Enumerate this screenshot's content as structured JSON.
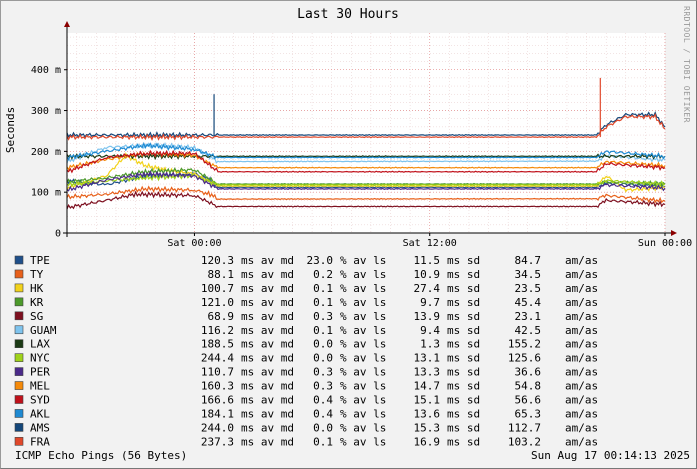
{
  "chart_data": {
    "type": "line",
    "title": "Last 30 Hours",
    "ylabel": "Seconds",
    "ylim": [
      0,
      490
    ],
    "y_ticks": [
      {
        "value": 0,
        "label": "0"
      },
      {
        "value": 100,
        "label": "100 m"
      },
      {
        "value": 200,
        "label": "200 m"
      },
      {
        "value": 300,
        "label": "300 m"
      },
      {
        "value": 400,
        "label": "400 m"
      }
    ],
    "xlim_hours": [
      -6.5,
      24
    ],
    "x_ticks": [
      {
        "value": 0,
        "label": "Sat 00:00"
      },
      {
        "value": 12,
        "label": "Sat 12:00"
      },
      {
        "value": 24,
        "label": "Sun 00:00"
      }
    ],
    "grid": true,
    "side_credit": "RRDTOOL / TOBI OETIKER",
    "legend_placement": "below",
    "series": [
      {
        "name": "TPE",
        "color": "#1f4f8a",
        "avg": "120.3",
        "loss": "23.0",
        "sd": "11.5",
        "amas": "84.7",
        "seg": [
          [
            -6.5,
            128
          ],
          [
            -4.5,
            118
          ],
          [
            -2.5,
            140
          ],
          [
            0,
            145
          ],
          [
            0.8,
            130
          ],
          [
            1.2,
            112
          ],
          [
            20.5,
            112
          ],
          [
            21,
            122
          ],
          [
            24,
            115
          ]
        ]
      },
      {
        "name": "TY",
        "color": "#e8601a",
        "avg": "88.1",
        "loss": "0.2",
        "sd": "10.9",
        "amas": "34.5",
        "seg": [
          [
            -6.5,
            88
          ],
          [
            -4.5,
            95
          ],
          [
            -2.5,
            108
          ],
          [
            0,
            105
          ],
          [
            0.8,
            95
          ],
          [
            1.2,
            83
          ],
          [
            20.5,
            84
          ],
          [
            21,
            92
          ],
          [
            24,
            78
          ]
        ]
      },
      {
        "name": "HK",
        "color": "#f2d21b",
        "avg": "100.7",
        "loss": "0.1",
        "sd": "27.4",
        "amas": "23.5",
        "seg": [
          [
            -6.5,
            110
          ],
          [
            -4.5,
            140
          ],
          [
            -3.5,
            190
          ],
          [
            -2.5,
            165
          ],
          [
            -1,
            150
          ],
          [
            0,
            145
          ],
          [
            1.2,
            115
          ],
          [
            20.5,
            115
          ],
          [
            21,
            140
          ],
          [
            22,
            105
          ],
          [
            24,
            112
          ]
        ]
      },
      {
        "name": "KR",
        "color": "#4c9a2a",
        "avg": "121.0",
        "loss": "0.1",
        "sd": "9.7",
        "amas": "45.4",
        "seg": [
          [
            -6.5,
            125
          ],
          [
            -4.5,
            135
          ],
          [
            -2.5,
            150
          ],
          [
            0,
            155
          ],
          [
            1.2,
            120
          ],
          [
            20.5,
            120
          ],
          [
            21,
            125
          ],
          [
            24,
            120
          ]
        ]
      },
      {
        "name": "SG",
        "color": "#7d0f1f",
        "avg": "68.9",
        "loss": "0.3",
        "sd": "13.9",
        "amas": "23.1",
        "seg": [
          [
            -6.5,
            62
          ],
          [
            -4.5,
            80
          ],
          [
            -3,
            95
          ],
          [
            0,
            92
          ],
          [
            1.2,
            65
          ],
          [
            20.5,
            65
          ],
          [
            21,
            80
          ],
          [
            24,
            70
          ]
        ]
      },
      {
        "name": "GUAM",
        "color": "#7fc4ee",
        "avg": "116.2",
        "loss": "0.1",
        "sd": "9.4",
        "amas": "42.5",
        "seg": [
          [
            -6.5,
            175
          ],
          [
            -4.5,
            210
          ],
          [
            -2,
            215
          ],
          [
            0,
            210
          ],
          [
            1.2,
            175
          ],
          [
            20.5,
            176
          ],
          [
            21,
            190
          ],
          [
            24,
            178
          ]
        ]
      },
      {
        "name": "LAX",
        "color": "#1b3a14",
        "avg": "188.5",
        "loss": "0.0",
        "sd": "1.3",
        "amas": "155.2",
        "seg": [
          [
            -6.5,
            188
          ],
          [
            24,
            188
          ]
        ]
      },
      {
        "name": "NYC",
        "color": "#9fd21a",
        "avg": "244.4",
        "loss": "0.0",
        "sd": "13.1",
        "amas": "125.6",
        "seg": [
          [
            -6.5,
            118
          ],
          [
            -4.5,
            128
          ],
          [
            -2.5,
            135
          ],
          [
            0,
            140
          ],
          [
            1.2,
            118
          ],
          [
            20.5,
            118
          ],
          [
            21,
            128
          ],
          [
            24,
            120
          ]
        ]
      },
      {
        "name": "PER",
        "color": "#4b2a8a",
        "avg": "110.7",
        "loss": "0.3",
        "sd": "13.3",
        "amas": "36.6",
        "seg": [
          [
            -6.5,
            105
          ],
          [
            -4.5,
            130
          ],
          [
            -2.5,
            145
          ],
          [
            0,
            140
          ],
          [
            1.2,
            108
          ],
          [
            20.5,
            108
          ],
          [
            21,
            118
          ],
          [
            24,
            110
          ]
        ]
      },
      {
        "name": "MEL",
        "color": "#f58a0a",
        "avg": "160.3",
        "loss": "0.3",
        "sd": "14.7",
        "amas": "54.8",
        "seg": [
          [
            -6.5,
            160
          ],
          [
            -4.5,
            180
          ],
          [
            -2.5,
            195
          ],
          [
            0,
            190
          ],
          [
            1.2,
            160
          ],
          [
            20.5,
            160
          ],
          [
            21,
            175
          ],
          [
            24,
            165
          ]
        ]
      },
      {
        "name": "SYD",
        "color": "#c0101a",
        "avg": "166.6",
        "loss": "0.4",
        "sd": "15.1",
        "amas": "56.6",
        "seg": [
          [
            -6.5,
            150
          ],
          [
            -4.5,
            185
          ],
          [
            -2.5,
            195
          ],
          [
            0,
            195
          ],
          [
            1.2,
            150
          ],
          [
            20.5,
            150
          ],
          [
            21,
            170
          ],
          [
            24,
            160
          ]
        ]
      },
      {
        "name": "AKL",
        "color": "#1f8ad2",
        "avg": "184.1",
        "loss": "0.4",
        "sd": "13.6",
        "amas": "65.3",
        "seg": [
          [
            -6.5,
            185
          ],
          [
            -4.5,
            200
          ],
          [
            -2.5,
            215
          ],
          [
            0,
            205
          ],
          [
            1.2,
            185
          ],
          [
            20.5,
            185
          ],
          [
            21,
            200
          ],
          [
            24,
            188
          ]
        ]
      },
      {
        "name": "AMS",
        "color": "#14477a",
        "avg": "244.0",
        "loss": "0.0",
        "sd": "15.3",
        "amas": "112.7",
        "seg": [
          [
            -6.5,
            240
          ],
          [
            20.5,
            240
          ],
          [
            21,
            265
          ],
          [
            22,
            290
          ],
          [
            23.5,
            290
          ],
          [
            24,
            260
          ]
        ],
        "spike": {
          "x": 1,
          "y": 340
        }
      },
      {
        "name": "FRA",
        "color": "#e0482a",
        "avg": "237.3",
        "loss": "0.1",
        "sd": "16.9",
        "amas": "103.2",
        "seg": [
          [
            -6.5,
            235
          ],
          [
            20.5,
            235
          ],
          [
            21,
            260
          ],
          [
            22,
            285
          ],
          [
            23.5,
            285
          ],
          [
            24,
            255
          ]
        ],
        "spike": {
          "x": 20.7,
          "y": 380
        }
      }
    ]
  },
  "legend_units": {
    "avg": "ms av md",
    "loss": "% av ls",
    "sd": "ms sd",
    "amas": "am/as"
  },
  "footer": {
    "left": "ICMP Echo Pings (56 Bytes)",
    "right": "Sun Aug 17 00:14:13 2025"
  }
}
